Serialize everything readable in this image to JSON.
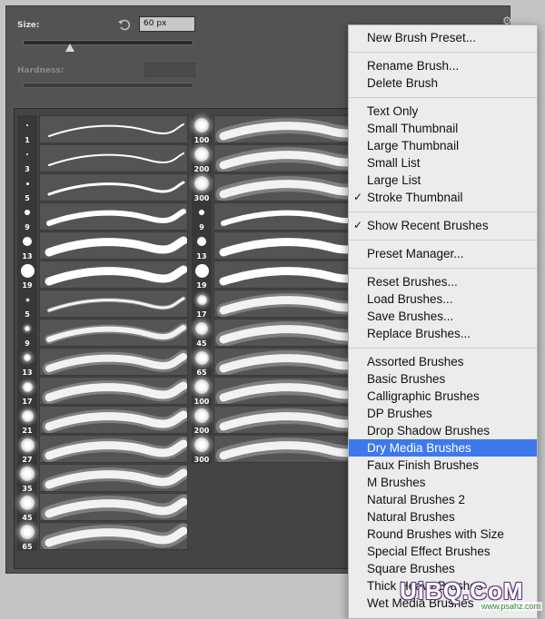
{
  "brush_panel": {
    "size_label": "Size:",
    "size_value": "60 px",
    "size_slider_fraction": 0.28,
    "hardness_label": "Hardness:"
  },
  "presets_col1": [
    {
      "size": "1",
      "tip": 2,
      "blur": 0
    },
    {
      "size": "3",
      "tip": 2,
      "blur": 0
    },
    {
      "size": "5",
      "tip": 3,
      "blur": 0
    },
    {
      "size": "9",
      "tip": 6,
      "blur": 0
    },
    {
      "size": "13",
      "tip": 10,
      "blur": 0
    },
    {
      "size": "19",
      "tip": 15,
      "blur": 0
    },
    {
      "size": "5",
      "tip": 3,
      "blur": 1
    },
    {
      "size": "9",
      "tip": 6,
      "blur": 2
    },
    {
      "size": "13",
      "tip": 8,
      "blur": 3
    },
    {
      "size": "17",
      "tip": 11,
      "blur": 3
    },
    {
      "size": "21",
      "tip": 13,
      "blur": 3
    },
    {
      "size": "27",
      "tip": 15,
      "blur": 3
    },
    {
      "size": "35",
      "tip": 16,
      "blur": 3
    },
    {
      "size": "45",
      "tip": 16,
      "blur": 4
    },
    {
      "size": "65",
      "tip": 16,
      "blur": 4
    }
  ],
  "presets_col2": [
    {
      "size": "100",
      "tip": 16,
      "blur": 4
    },
    {
      "size": "200",
      "tip": 16,
      "blur": 4
    },
    {
      "size": "300",
      "tip": 16,
      "blur": 4
    },
    {
      "size": "9",
      "tip": 6,
      "blur": 0
    },
    {
      "size": "13",
      "tip": 10,
      "blur": 0
    },
    {
      "size": "19",
      "tip": 15,
      "blur": 0
    },
    {
      "size": "17",
      "tip": 11,
      "blur": 3
    },
    {
      "size": "45",
      "tip": 14,
      "blur": 4
    },
    {
      "size": "65",
      "tip": 15,
      "blur": 4
    },
    {
      "size": "100",
      "tip": 16,
      "blur": 4
    },
    {
      "size": "200",
      "tip": 16,
      "blur": 4
    },
    {
      "size": "300",
      "tip": 16,
      "blur": 4
    }
  ],
  "menu": {
    "selected_color": "#3d79ea",
    "groups": [
      [
        {
          "label": "New Brush Preset..."
        }
      ],
      [
        {
          "label": "Rename Brush..."
        },
        {
          "label": "Delete Brush"
        }
      ],
      [
        {
          "label": "Text Only"
        },
        {
          "label": "Small Thumbnail"
        },
        {
          "label": "Large Thumbnail"
        },
        {
          "label": "Small List"
        },
        {
          "label": "Large List"
        },
        {
          "label": "Stroke Thumbnail",
          "checked": true
        }
      ],
      [
        {
          "label": "Show Recent Brushes",
          "checked": true
        }
      ],
      [
        {
          "label": "Preset Manager..."
        }
      ],
      [
        {
          "label": "Reset Brushes..."
        },
        {
          "label": "Load Brushes..."
        },
        {
          "label": "Save Brushes..."
        },
        {
          "label": "Replace Brushes..."
        }
      ],
      [
        {
          "label": "Assorted Brushes"
        },
        {
          "label": "Basic Brushes"
        },
        {
          "label": "Calligraphic Brushes"
        },
        {
          "label": "DP Brushes"
        },
        {
          "label": "Drop Shadow Brushes"
        },
        {
          "label": "Dry Media Brushes",
          "selected": true
        },
        {
          "label": "Faux Finish Brushes"
        },
        {
          "label": "M Brushes"
        },
        {
          "label": "Natural Brushes 2"
        },
        {
          "label": "Natural Brushes"
        },
        {
          "label": "Round Brushes with Size"
        },
        {
          "label": "Special Effect Brushes"
        },
        {
          "label": "Square Brushes"
        },
        {
          "label": "Thick Heavy Brushes"
        },
        {
          "label": "Wet Media Brushes"
        }
      ]
    ]
  },
  "watermark": {
    "text": "UiBQ.CoM",
    "sub": "www.psahz.com"
  },
  "icons": {
    "reset": "reset-arrow-icon",
    "gear": "gear-icon",
    "check": "checkmark-icon"
  }
}
